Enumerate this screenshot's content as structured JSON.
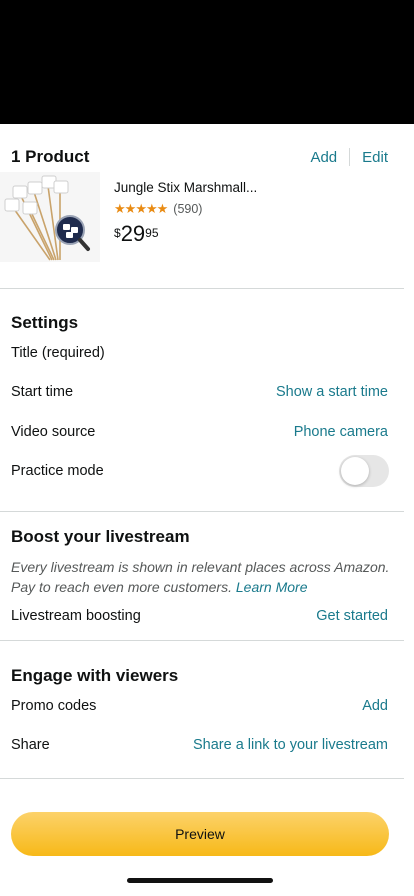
{
  "product": {
    "header": "1 Product",
    "add_label": "Add",
    "edit_label": "Edit",
    "title": "Jungle Stix Marshmall...",
    "rating_stars": 5,
    "review_count": "(590)",
    "price_currency": "$",
    "price_whole": "29",
    "price_fraction": "95",
    "star_color": "#e98b13"
  },
  "settings": {
    "header": "Settings",
    "title_label": "Title (required)",
    "start_time_label": "Start time",
    "start_time_value": "Show a start time",
    "video_source_label": "Video source",
    "video_source_value": "Phone camera",
    "practice_mode_label": "Practice mode",
    "practice_mode_on": false
  },
  "boost": {
    "header": "Boost your livestream",
    "description": "Every livestream is shown in relevant places across Amazon. Pay to reach even more customers.",
    "learn_more": "Learn More",
    "boosting_label": "Livestream boosting",
    "boosting_value": "Get started"
  },
  "engage": {
    "header": "Engage with viewers",
    "promo_label": "Promo codes",
    "promo_value": "Add",
    "share_label": "Share",
    "share_value": "Share a link to your livestream"
  },
  "footer": {
    "preview_label": "Preview"
  },
  "colors": {
    "link": "#1a7a8c",
    "button_yellow": "#f7b918",
    "divider": "#d5d9d9"
  }
}
